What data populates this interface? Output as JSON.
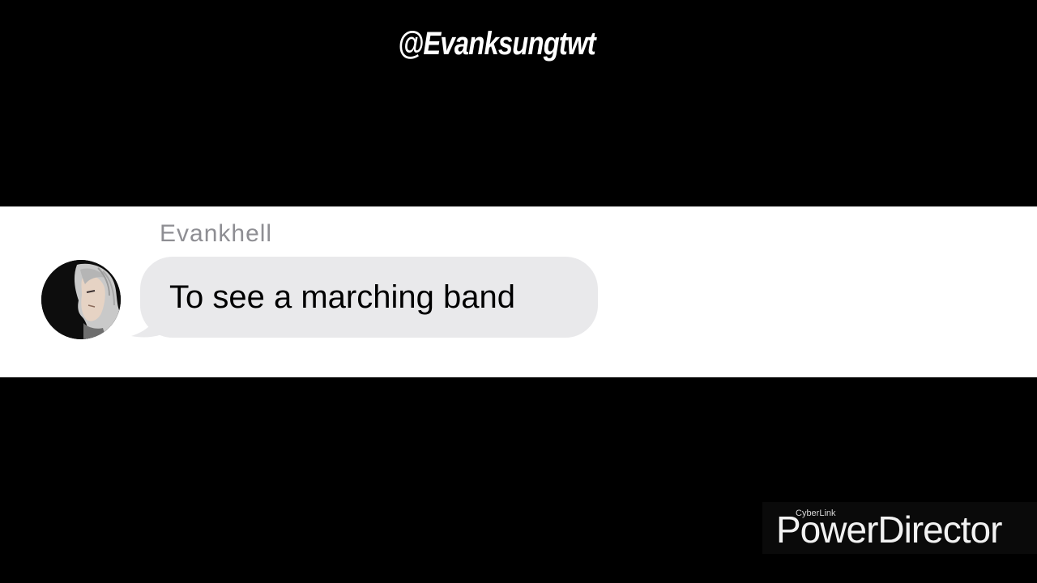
{
  "overlay": {
    "handle": "@Evanksungtwt"
  },
  "message": {
    "sender": "Evankhell",
    "text": "To see a marching band",
    "bubble_color": "#e9e9eb",
    "sender_color": "#8e8e93"
  },
  "watermark": {
    "brand": "CyberLink",
    "product": "PowerDirector"
  },
  "colors": {
    "background": "#000000",
    "chat_background": "#ffffff"
  }
}
